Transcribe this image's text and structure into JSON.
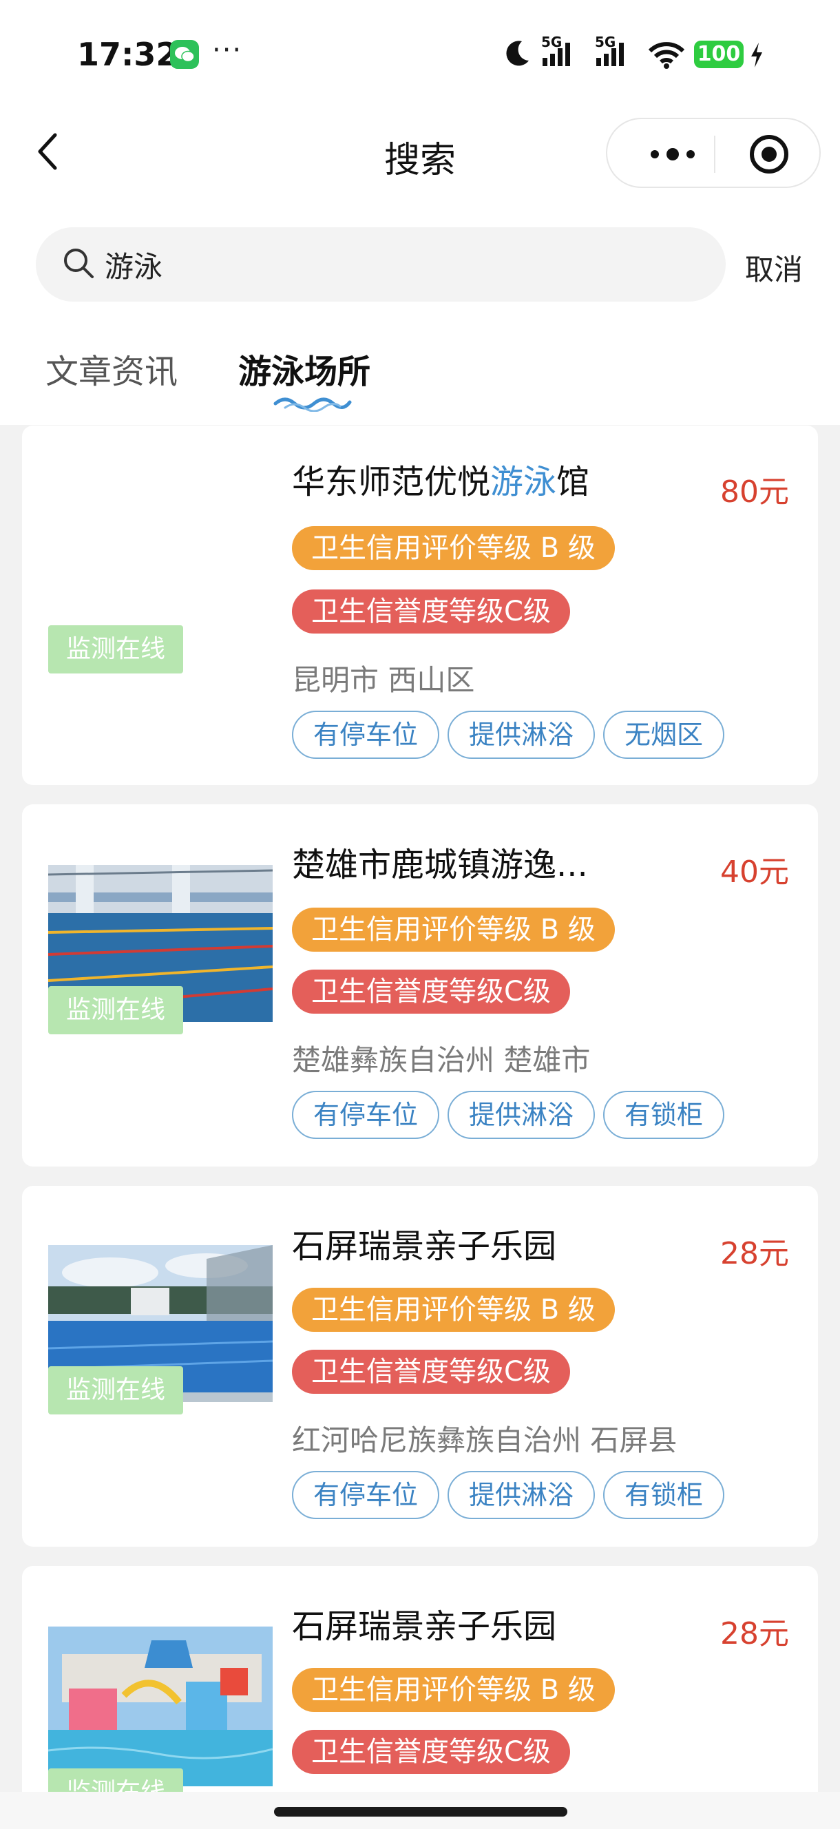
{
  "status_bar": {
    "time": "17:32",
    "dots": "···",
    "network1": "5G",
    "network2": "5G",
    "battery": "100"
  },
  "nav": {
    "title": "搜索"
  },
  "search": {
    "value": "游泳",
    "cancel": "取消"
  },
  "tabs": [
    {
      "label": "文章资讯",
      "active": false
    },
    {
      "label": "游泳场所",
      "active": true
    }
  ],
  "colors": {
    "accent": "#3f8fd2",
    "price": "#d7412f",
    "pill_orange": "#f2a23a",
    "pill_red": "#e45f5a",
    "monitor": "#b7e6b0"
  },
  "venues": [
    {
      "name_pre": "华东师范优悦",
      "name_hl": "游泳",
      "name_post": "馆",
      "price": "80元",
      "credit_rating": "卫生信用评价等级 B 级",
      "reputation_rating": "卫生信誉度等级C级",
      "location": "昆明市 西山区",
      "tags": [
        "有停车位",
        "提供淋浴",
        "无烟区"
      ],
      "monitor": "监测在线",
      "image": "none"
    },
    {
      "name": "楚雄市鹿城镇游逸...",
      "price": "40元",
      "credit_rating": "卫生信用评价等级 B 级",
      "reputation_rating": "卫生信誉度等级C级",
      "location": "楚雄彝族自治州 楚雄市",
      "tags": [
        "有停车位",
        "提供淋浴",
        "有锁柜"
      ],
      "monitor": "监测在线",
      "image": "indoor-pool-photo"
    },
    {
      "name": "石屏瑞景亲子乐园",
      "price": "28元",
      "credit_rating": "卫生信用评价等级 B 级",
      "reputation_rating": "卫生信誉度等级C级",
      "location": "红河哈尼族彝族自治州 石屏县",
      "tags": [
        "有停车位",
        "提供淋浴",
        "有锁柜"
      ],
      "monitor": "监测在线",
      "image": "outdoor-pool-photo"
    },
    {
      "name": "石屏瑞景亲子乐园",
      "price": "28元",
      "credit_rating": "卫生信用评价等级 B 级",
      "reputation_rating": "卫生信誉度等级C级",
      "monitor": "监测在线",
      "image": "water-park-photo"
    }
  ]
}
